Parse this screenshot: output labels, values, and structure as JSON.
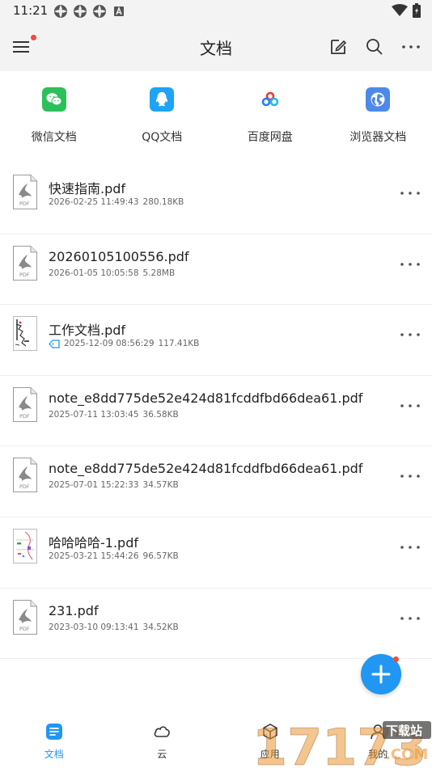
{
  "status_bar": {
    "time": "11:21",
    "icons": [
      "app-notification-icon",
      "app-notification-icon",
      "app-notification-icon",
      "a-badge-icon"
    ],
    "right_icons": [
      "wifi-icon",
      "battery-icon"
    ]
  },
  "header": {
    "title": "文档",
    "actions": [
      "edit-icon",
      "search-icon",
      "more-icon"
    ],
    "menu_badge_color": "#f24a3c"
  },
  "sources": [
    {
      "label": "微信文档",
      "icon": "wechat-icon",
      "color": "#2cc05a"
    },
    {
      "label": "QQ文档",
      "icon": "qq-icon",
      "color": "#1fa3f5"
    },
    {
      "label": "百度网盘",
      "icon": "baidu-netdisk-icon",
      "color": "#e4412f"
    },
    {
      "label": "浏览器文档",
      "icon": "browser-icon",
      "color": "#4d8ae8"
    }
  ],
  "files": [
    {
      "name": "快速指南.pdf",
      "date": "2026-02-25 11:49:43",
      "size": "280.18KB",
      "thumb": "pdf",
      "tagged": false
    },
    {
      "name": "20260105100556.pdf",
      "date": "2026-01-05 10:05:58",
      "size": "5.28MB",
      "thumb": "pdf",
      "tagged": false
    },
    {
      "name": "工作文档.pdf",
      "date": "2025-12-09 08:56:29",
      "size": "117.41KB",
      "thumb": "preview",
      "tagged": true
    },
    {
      "name": "note_e8dd775de52e424d81fcddfbd66dea61.pdf",
      "date": "2025-07-11 13:03:45",
      "size": "36.58KB",
      "thumb": "pdf",
      "tagged": false
    },
    {
      "name": "note_e8dd775de52e424d81fcddfbd66dea61.pdf",
      "date": "2025-07-01 15:22:33",
      "size": "34.57KB",
      "thumb": "pdf",
      "tagged": false
    },
    {
      "name": "哈哈哈哈-1.pdf",
      "date": "2025-03-21 15:44:26",
      "size": "96.57KB",
      "thumb": "preview-color",
      "tagged": false
    },
    {
      "name": "231.pdf",
      "date": "2023-03-10 09:13:41",
      "size": "34.52KB",
      "thumb": "pdf",
      "tagged": false
    }
  ],
  "pdf_thumb_label": "PDF",
  "fab": {
    "icon": "plus-icon",
    "color": "#2196f3"
  },
  "bottom_nav": [
    {
      "label": "文档",
      "icon": "document-icon",
      "active": true
    },
    {
      "label": "云",
      "icon": "cloud-icon",
      "active": false
    },
    {
      "label": "应用",
      "icon": "apps-icon",
      "active": false
    },
    {
      "label": "我的",
      "icon": "user-icon",
      "active": false
    }
  ],
  "watermark": {
    "number": "17173",
    "text": "下载站",
    "domain": ".COM"
  }
}
